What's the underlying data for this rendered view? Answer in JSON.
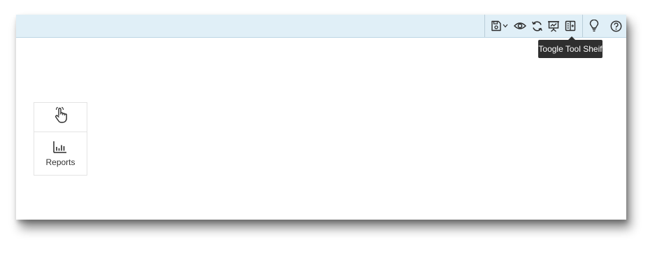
{
  "toolbar": {
    "buttons": [
      {
        "name": "save-dropdown",
        "icon": "save-icon",
        "caret": "chevron-down-icon"
      },
      {
        "name": "preview",
        "icon": "eye-icon"
      },
      {
        "name": "refresh",
        "icon": "refresh-icon"
      },
      {
        "name": "presentation",
        "icon": "presentation-icon"
      },
      {
        "name": "toggle-tool-shelf",
        "icon": "tool-shelf-icon"
      },
      {
        "name": "hint",
        "icon": "lightbulb-icon"
      },
      {
        "name": "help",
        "icon": "help-circle-icon"
      }
    ],
    "tooltip": "Toogle Tool Sheif"
  },
  "canvas": {
    "card": {
      "top_icon": "hand-pointer-icon",
      "report_icon": "bar-chart-icon",
      "label": "Reports"
    }
  },
  "colors": {
    "toolbar_bg": "#e0eff7",
    "icon": "#2b2b2b",
    "tooltip_bg": "#2f2f2f"
  }
}
